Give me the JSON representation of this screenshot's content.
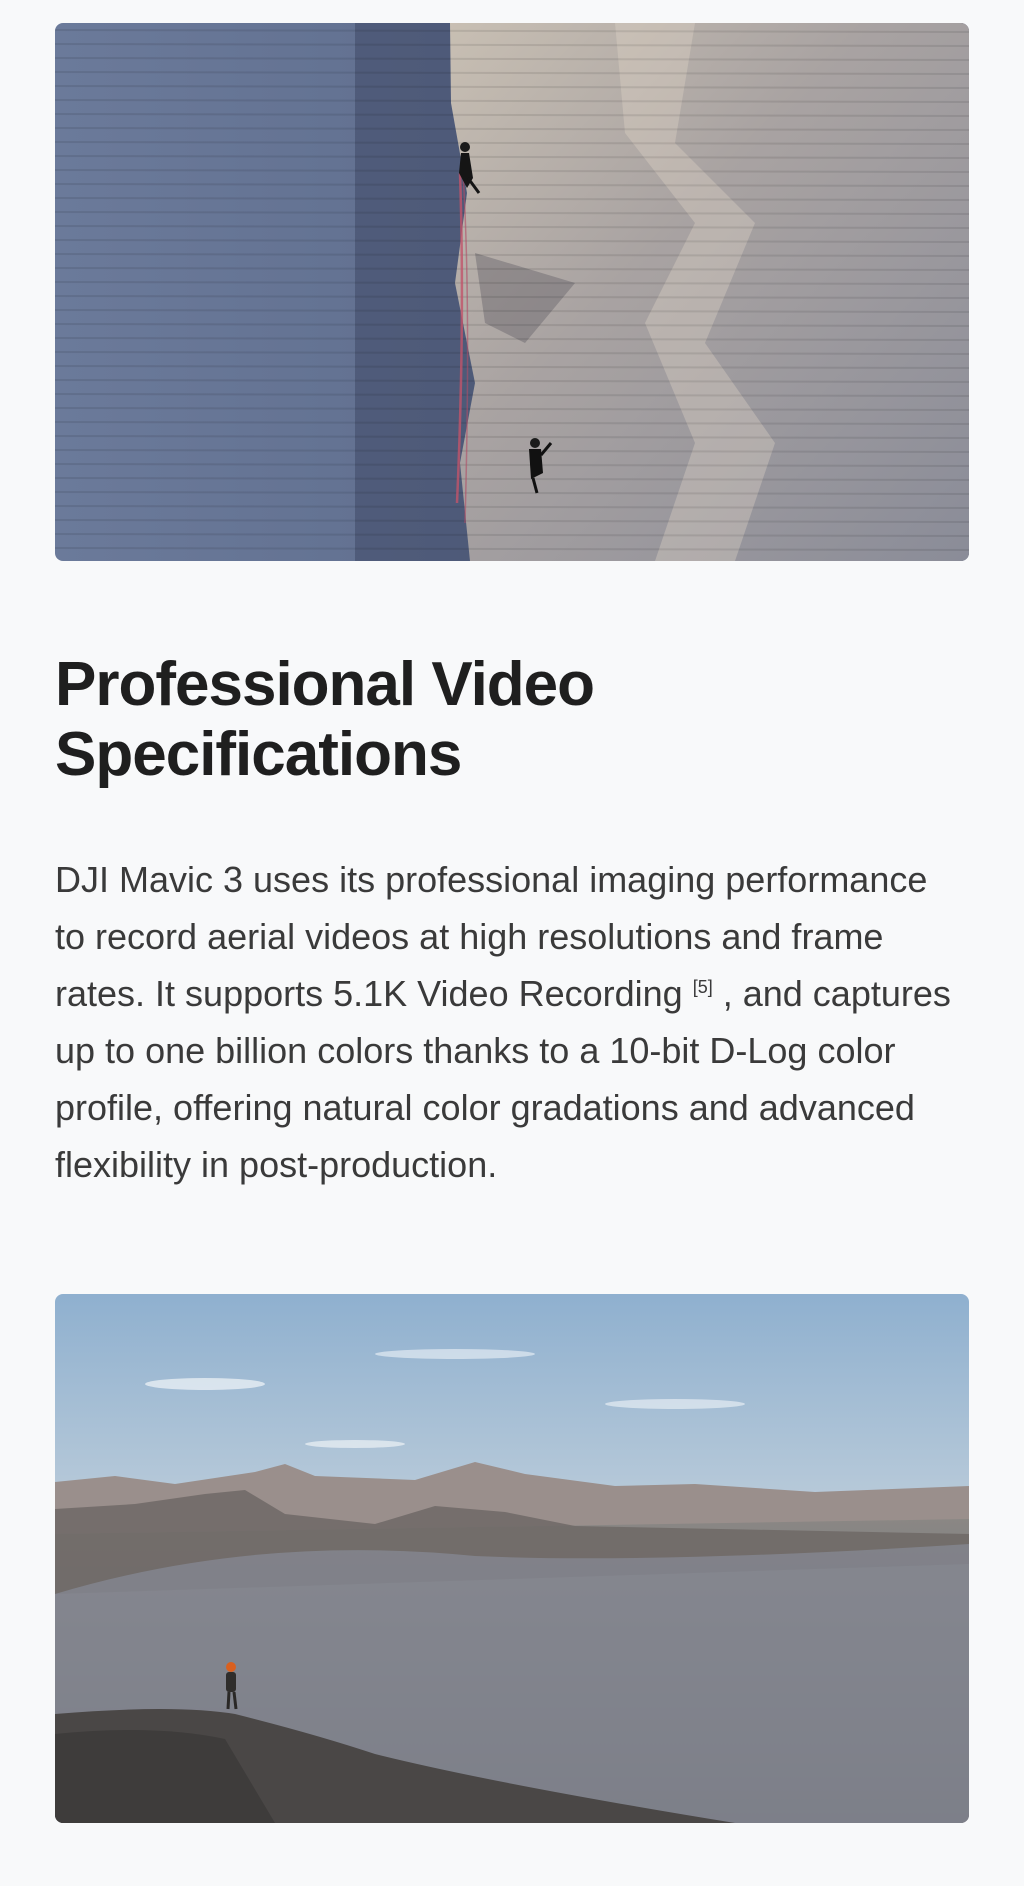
{
  "section": {
    "title_line1": "Professional Video",
    "title_line2": "Specifications",
    "body_part1": "DJI Mavic 3 uses its professional imaging performance to record aerial videos at high resolutions and frame rates. It supports 5.1K Video Recording",
    "footnote": "[5]",
    "body_part2": " , and captures up to one billion colors thanks to a 10-bit D-Log color profile, offering natural color gradations and advanced flexibility in post-production."
  },
  "colors": {
    "page_bg": "#f8f9fa",
    "title": "#1f1f1f",
    "body": "#3a3a3a"
  }
}
